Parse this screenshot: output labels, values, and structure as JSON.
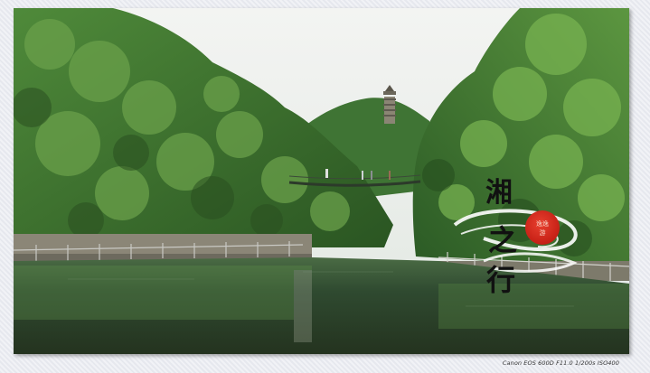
{
  "scene": {
    "description_subjects": [
      "pagoda-on-hill",
      "forested-valley",
      "suspension-bridge",
      "calm-lake"
    ],
    "colors": {
      "sky": "#eef0ee",
      "foliage_dark": "#2c5a22",
      "foliage_mid": "#4f8a3a",
      "foliage_light": "#7fb35a",
      "water": "#2f4a32",
      "seal_red": "#d42a1f"
    }
  },
  "watermark": {
    "calligraphy": "湘之行",
    "seal_text": "逸逸游"
  },
  "exif_caption": "Canon EOS 600D F11.0 1/200s ISO400"
}
